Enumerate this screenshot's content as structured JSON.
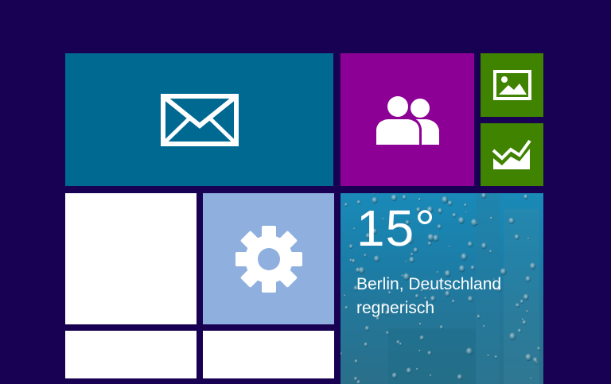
{
  "start_screen": {
    "background_color": "#180052",
    "tiles": {
      "mail": {
        "icon": "mail-icon",
        "color": "#006992"
      },
      "people": {
        "icon": "people-icon",
        "color": "#8c0095"
      },
      "photos": {
        "icon": "photo-icon",
        "color": "#3f8300"
      },
      "finance": {
        "icon": "finance-chart-icon",
        "color": "#3f8300"
      },
      "settings": {
        "icon": "gear-icon",
        "color": "#8fb0de"
      },
      "weather": {
        "temperature": "15°",
        "location": "Berlin, Deutschland",
        "condition": "regnerisch",
        "background": "rainy-window"
      }
    }
  }
}
